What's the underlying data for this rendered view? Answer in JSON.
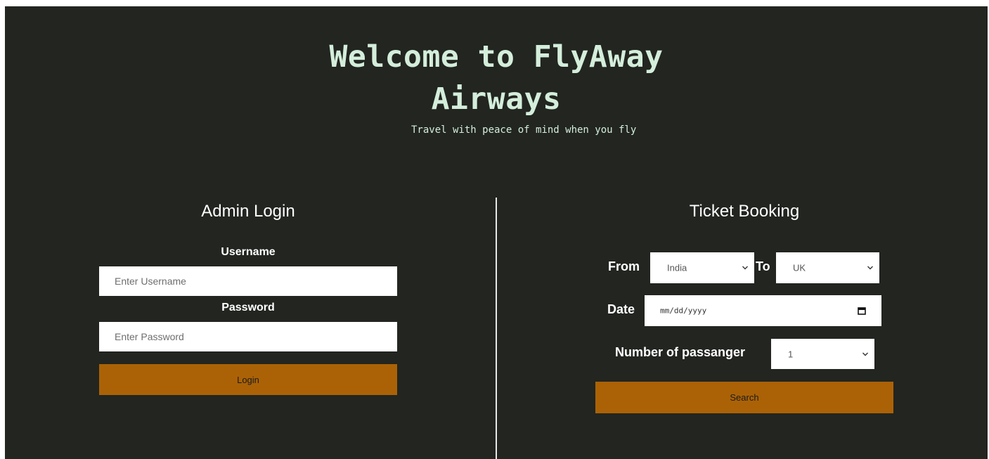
{
  "header": {
    "title_line1": "Welcome to FlyAway",
    "title_line2": "Airways",
    "subtitle": "Travel with peace of mind when you fly"
  },
  "admin_login": {
    "title": "Admin Login",
    "username_label": "Username",
    "username_placeholder": "Enter Username",
    "password_label": "Password",
    "password_placeholder": "Enter Password",
    "login_button": "Login"
  },
  "ticket_booking": {
    "title": "Ticket Booking",
    "from_label": "From",
    "from_value": "India",
    "to_label": "To",
    "to_value": "UK",
    "date_label": "Date",
    "date_placeholder": "mm/dd/yyyy",
    "passengers_label": "Number of passanger",
    "passengers_value": "1",
    "search_button": "Search"
  },
  "colors": {
    "background": "#222520",
    "title_text": "#d4eedb",
    "button": "#ab6206",
    "divider": "#e7e7e7"
  },
  "icons": {
    "select_arrow": "chevron-down-icon",
    "date_picker": "calendar-icon"
  }
}
